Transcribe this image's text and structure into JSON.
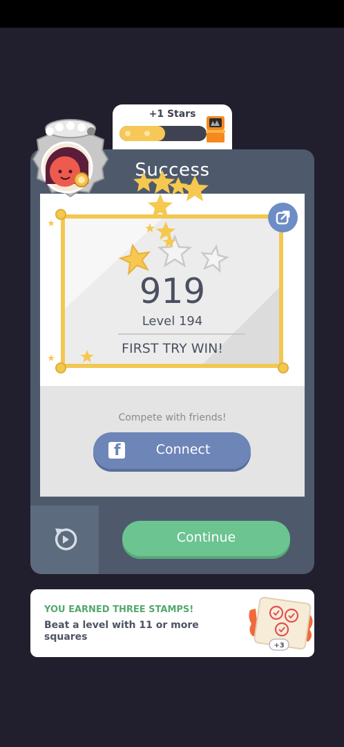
{
  "stars_progress": {
    "label": "+1 Stars",
    "fill_fraction": 0.52
  },
  "card": {
    "title": "Success",
    "score": "919",
    "level_label": "Level 194",
    "result_label": "FIRST TRY WIN!",
    "stars_earned": 1,
    "stars_total": 3,
    "compete_text": "Compete with friends!",
    "connect_label": "Connect",
    "continue_label": "Continue"
  },
  "stamp_banner": {
    "title": "YOU EARNED THREE STAMPS!",
    "description": "Beat a level with 11 or more squares",
    "stamp_count": "+3"
  },
  "colors": {
    "background": "#211f2e",
    "card": "#4e5a6c",
    "gold": "#f2c752",
    "connect": "#6d86b7",
    "continue": "#6cc490",
    "stamp_title": "#54a86d"
  },
  "icons": {
    "share": "share-icon",
    "facebook": "facebook-icon",
    "retry": "retry-icon",
    "chest": "chest-icon",
    "avatar": "avatar-icon"
  }
}
